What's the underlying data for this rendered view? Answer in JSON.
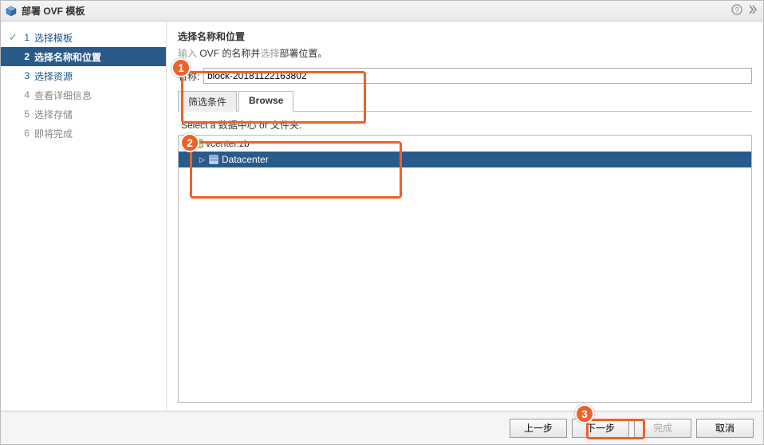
{
  "titlebar": {
    "title": "部署 OVF 模板"
  },
  "steps": [
    {
      "num": "1",
      "label": "选择模板",
      "state": "completed"
    },
    {
      "num": "2",
      "label": "选择名称和位置",
      "state": "current"
    },
    {
      "num": "3",
      "label": "选择资源",
      "state": "enabled"
    },
    {
      "num": "4",
      "label": "查看详细信息",
      "state": "pending"
    },
    {
      "num": "5",
      "label": "选择存储",
      "state": "pending"
    },
    {
      "num": "6",
      "label": "即将完成",
      "state": "pending"
    }
  ],
  "main": {
    "heading": "选择名称和位置",
    "subtitlePrefix": "输入",
    "subtitleMid1": " OVF 的名称并",
    "subtitleGray": "选择",
    "subtitleEnd": "部署位置。",
    "nameLabel": "名称:",
    "nameValue": "block-20181122163802",
    "tabFilter": "筛选条件",
    "tabBrowse": "Browse",
    "folderLabel": "Select a 数据中心 or 文件夹.",
    "tree": {
      "root": "vcenter.zb",
      "child": "Datacenter"
    }
  },
  "footer": {
    "back": "上一步",
    "next": "下一步",
    "finish": "完成",
    "cancel": "取消"
  },
  "callouts": {
    "c1": "1",
    "c2": "2",
    "c3": "3"
  }
}
